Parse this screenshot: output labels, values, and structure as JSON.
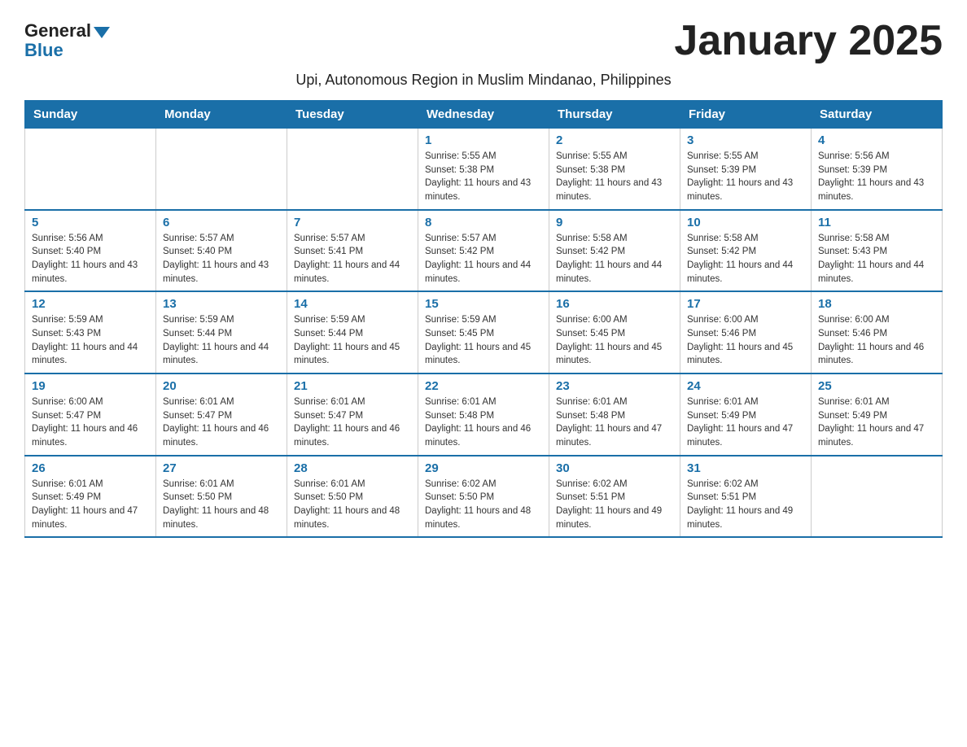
{
  "logo": {
    "general": "General",
    "blue": "Blue"
  },
  "title": "January 2025",
  "subtitle": "Upi, Autonomous Region in Muslim Mindanao, Philippines",
  "days_of_week": [
    "Sunday",
    "Monday",
    "Tuesday",
    "Wednesday",
    "Thursday",
    "Friday",
    "Saturday"
  ],
  "weeks": [
    [
      {
        "day": "",
        "sunrise": "",
        "sunset": "",
        "daylight": ""
      },
      {
        "day": "",
        "sunrise": "",
        "sunset": "",
        "daylight": ""
      },
      {
        "day": "",
        "sunrise": "",
        "sunset": "",
        "daylight": ""
      },
      {
        "day": "1",
        "sunrise": "Sunrise: 5:55 AM",
        "sunset": "Sunset: 5:38 PM",
        "daylight": "Daylight: 11 hours and 43 minutes."
      },
      {
        "day": "2",
        "sunrise": "Sunrise: 5:55 AM",
        "sunset": "Sunset: 5:38 PM",
        "daylight": "Daylight: 11 hours and 43 minutes."
      },
      {
        "day": "3",
        "sunrise": "Sunrise: 5:55 AM",
        "sunset": "Sunset: 5:39 PM",
        "daylight": "Daylight: 11 hours and 43 minutes."
      },
      {
        "day": "4",
        "sunrise": "Sunrise: 5:56 AM",
        "sunset": "Sunset: 5:39 PM",
        "daylight": "Daylight: 11 hours and 43 minutes."
      }
    ],
    [
      {
        "day": "5",
        "sunrise": "Sunrise: 5:56 AM",
        "sunset": "Sunset: 5:40 PM",
        "daylight": "Daylight: 11 hours and 43 minutes."
      },
      {
        "day": "6",
        "sunrise": "Sunrise: 5:57 AM",
        "sunset": "Sunset: 5:40 PM",
        "daylight": "Daylight: 11 hours and 43 minutes."
      },
      {
        "day": "7",
        "sunrise": "Sunrise: 5:57 AM",
        "sunset": "Sunset: 5:41 PM",
        "daylight": "Daylight: 11 hours and 44 minutes."
      },
      {
        "day": "8",
        "sunrise": "Sunrise: 5:57 AM",
        "sunset": "Sunset: 5:42 PM",
        "daylight": "Daylight: 11 hours and 44 minutes."
      },
      {
        "day": "9",
        "sunrise": "Sunrise: 5:58 AM",
        "sunset": "Sunset: 5:42 PM",
        "daylight": "Daylight: 11 hours and 44 minutes."
      },
      {
        "day": "10",
        "sunrise": "Sunrise: 5:58 AM",
        "sunset": "Sunset: 5:42 PM",
        "daylight": "Daylight: 11 hours and 44 minutes."
      },
      {
        "day": "11",
        "sunrise": "Sunrise: 5:58 AM",
        "sunset": "Sunset: 5:43 PM",
        "daylight": "Daylight: 11 hours and 44 minutes."
      }
    ],
    [
      {
        "day": "12",
        "sunrise": "Sunrise: 5:59 AM",
        "sunset": "Sunset: 5:43 PM",
        "daylight": "Daylight: 11 hours and 44 minutes."
      },
      {
        "day": "13",
        "sunrise": "Sunrise: 5:59 AM",
        "sunset": "Sunset: 5:44 PM",
        "daylight": "Daylight: 11 hours and 44 minutes."
      },
      {
        "day": "14",
        "sunrise": "Sunrise: 5:59 AM",
        "sunset": "Sunset: 5:44 PM",
        "daylight": "Daylight: 11 hours and 45 minutes."
      },
      {
        "day": "15",
        "sunrise": "Sunrise: 5:59 AM",
        "sunset": "Sunset: 5:45 PM",
        "daylight": "Daylight: 11 hours and 45 minutes."
      },
      {
        "day": "16",
        "sunrise": "Sunrise: 6:00 AM",
        "sunset": "Sunset: 5:45 PM",
        "daylight": "Daylight: 11 hours and 45 minutes."
      },
      {
        "day": "17",
        "sunrise": "Sunrise: 6:00 AM",
        "sunset": "Sunset: 5:46 PM",
        "daylight": "Daylight: 11 hours and 45 minutes."
      },
      {
        "day": "18",
        "sunrise": "Sunrise: 6:00 AM",
        "sunset": "Sunset: 5:46 PM",
        "daylight": "Daylight: 11 hours and 46 minutes."
      }
    ],
    [
      {
        "day": "19",
        "sunrise": "Sunrise: 6:00 AM",
        "sunset": "Sunset: 5:47 PM",
        "daylight": "Daylight: 11 hours and 46 minutes."
      },
      {
        "day": "20",
        "sunrise": "Sunrise: 6:01 AM",
        "sunset": "Sunset: 5:47 PM",
        "daylight": "Daylight: 11 hours and 46 minutes."
      },
      {
        "day": "21",
        "sunrise": "Sunrise: 6:01 AM",
        "sunset": "Sunset: 5:47 PM",
        "daylight": "Daylight: 11 hours and 46 minutes."
      },
      {
        "day": "22",
        "sunrise": "Sunrise: 6:01 AM",
        "sunset": "Sunset: 5:48 PM",
        "daylight": "Daylight: 11 hours and 46 minutes."
      },
      {
        "day": "23",
        "sunrise": "Sunrise: 6:01 AM",
        "sunset": "Sunset: 5:48 PM",
        "daylight": "Daylight: 11 hours and 47 minutes."
      },
      {
        "day": "24",
        "sunrise": "Sunrise: 6:01 AM",
        "sunset": "Sunset: 5:49 PM",
        "daylight": "Daylight: 11 hours and 47 minutes."
      },
      {
        "day": "25",
        "sunrise": "Sunrise: 6:01 AM",
        "sunset": "Sunset: 5:49 PM",
        "daylight": "Daylight: 11 hours and 47 minutes."
      }
    ],
    [
      {
        "day": "26",
        "sunrise": "Sunrise: 6:01 AM",
        "sunset": "Sunset: 5:49 PM",
        "daylight": "Daylight: 11 hours and 47 minutes."
      },
      {
        "day": "27",
        "sunrise": "Sunrise: 6:01 AM",
        "sunset": "Sunset: 5:50 PM",
        "daylight": "Daylight: 11 hours and 48 minutes."
      },
      {
        "day": "28",
        "sunrise": "Sunrise: 6:01 AM",
        "sunset": "Sunset: 5:50 PM",
        "daylight": "Daylight: 11 hours and 48 minutes."
      },
      {
        "day": "29",
        "sunrise": "Sunrise: 6:02 AM",
        "sunset": "Sunset: 5:50 PM",
        "daylight": "Daylight: 11 hours and 48 minutes."
      },
      {
        "day": "30",
        "sunrise": "Sunrise: 6:02 AM",
        "sunset": "Sunset: 5:51 PM",
        "daylight": "Daylight: 11 hours and 49 minutes."
      },
      {
        "day": "31",
        "sunrise": "Sunrise: 6:02 AM",
        "sunset": "Sunset: 5:51 PM",
        "daylight": "Daylight: 11 hours and 49 minutes."
      },
      {
        "day": "",
        "sunrise": "",
        "sunset": "",
        "daylight": ""
      }
    ]
  ]
}
